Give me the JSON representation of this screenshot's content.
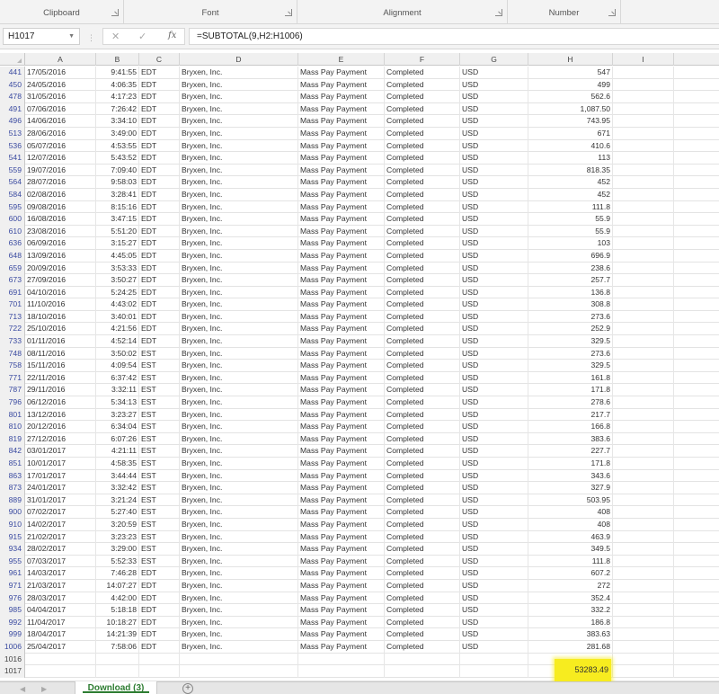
{
  "ribbon": {
    "groups": [
      {
        "label": "Clipboard"
      },
      {
        "label": "Font"
      },
      {
        "label": "Alignment"
      },
      {
        "label": "Number"
      }
    ]
  },
  "formula_bar": {
    "name_box": "H1017",
    "cancel_icon": "✕",
    "enter_icon": "✓",
    "fx_label": "fx",
    "formula": "=SUBTOTAL(9,H2:H1006)"
  },
  "columns": [
    "A",
    "B",
    "C",
    "D",
    "E",
    "F",
    "G",
    "H",
    "I"
  ],
  "rows": [
    {
      "n": "441",
      "A": "17/05/2016",
      "B": "9:41:55",
      "C": "EDT",
      "D": "Bryxen, Inc.",
      "E": "Mass Pay Payment",
      "F": "Completed",
      "G": "USD",
      "H": "547"
    },
    {
      "n": "450",
      "A": "24/05/2016",
      "B": "4:06:35",
      "C": "EDT",
      "D": "Bryxen, Inc.",
      "E": "Mass Pay Payment",
      "F": "Completed",
      "G": "USD",
      "H": "499"
    },
    {
      "n": "478",
      "A": "31/05/2016",
      "B": "4:17:23",
      "C": "EDT",
      "D": "Bryxen, Inc.",
      "E": "Mass Pay Payment",
      "F": "Completed",
      "G": "USD",
      "H": "562.6"
    },
    {
      "n": "491",
      "A": "07/06/2016",
      "B": "7:26:42",
      "C": "EDT",
      "D": "Bryxen, Inc.",
      "E": "Mass Pay Payment",
      "F": "Completed",
      "G": "USD",
      "H": "1,087.50"
    },
    {
      "n": "496",
      "A": "14/06/2016",
      "B": "3:34:10",
      "C": "EDT",
      "D": "Bryxen, Inc.",
      "E": "Mass Pay Payment",
      "F": "Completed",
      "G": "USD",
      "H": "743.95"
    },
    {
      "n": "513",
      "A": "28/06/2016",
      "B": "3:49:00",
      "C": "EDT",
      "D": "Bryxen, Inc.",
      "E": "Mass Pay Payment",
      "F": "Completed",
      "G": "USD",
      "H": "671"
    },
    {
      "n": "536",
      "A": "05/07/2016",
      "B": "4:53:55",
      "C": "EDT",
      "D": "Bryxen, Inc.",
      "E": "Mass Pay Payment",
      "F": "Completed",
      "G": "USD",
      "H": "410.6"
    },
    {
      "n": "541",
      "A": "12/07/2016",
      "B": "5:43:52",
      "C": "EDT",
      "D": "Bryxen, Inc.",
      "E": "Mass Pay Payment",
      "F": "Completed",
      "G": "USD",
      "H": "113"
    },
    {
      "n": "559",
      "A": "19/07/2016",
      "B": "7:09:40",
      "C": "EDT",
      "D": "Bryxen, Inc.",
      "E": "Mass Pay Payment",
      "F": "Completed",
      "G": "USD",
      "H": "818.35"
    },
    {
      "n": "564",
      "A": "28/07/2016",
      "B": "9:58:03",
      "C": "EDT",
      "D": "Bryxen, Inc.",
      "E": "Mass Pay Payment",
      "F": "Completed",
      "G": "USD",
      "H": "452"
    },
    {
      "n": "584",
      "A": "02/08/2016",
      "B": "3:28:41",
      "C": "EDT",
      "D": "Bryxen, Inc.",
      "E": "Mass Pay Payment",
      "F": "Completed",
      "G": "USD",
      "H": "452"
    },
    {
      "n": "595",
      "A": "09/08/2016",
      "B": "8:15:16",
      "C": "EDT",
      "D": "Bryxen, Inc.",
      "E": "Mass Pay Payment",
      "F": "Completed",
      "G": "USD",
      "H": "111.8"
    },
    {
      "n": "600",
      "A": "16/08/2016",
      "B": "3:47:15",
      "C": "EDT",
      "D": "Bryxen, Inc.",
      "E": "Mass Pay Payment",
      "F": "Completed",
      "G": "USD",
      "H": "55.9"
    },
    {
      "n": "610",
      "A": "23/08/2016",
      "B": "5:51:20",
      "C": "EDT",
      "D": "Bryxen, Inc.",
      "E": "Mass Pay Payment",
      "F": "Completed",
      "G": "USD",
      "H": "55.9"
    },
    {
      "n": "636",
      "A": "06/09/2016",
      "B": "3:15:27",
      "C": "EDT",
      "D": "Bryxen, Inc.",
      "E": "Mass Pay Payment",
      "F": "Completed",
      "G": "USD",
      "H": "103"
    },
    {
      "n": "648",
      "A": "13/09/2016",
      "B": "4:45:05",
      "C": "EDT",
      "D": "Bryxen, Inc.",
      "E": "Mass Pay Payment",
      "F": "Completed",
      "G": "USD",
      "H": "696.9"
    },
    {
      "n": "659",
      "A": "20/09/2016",
      "B": "3:53:33",
      "C": "EDT",
      "D": "Bryxen, Inc.",
      "E": "Mass Pay Payment",
      "F": "Completed",
      "G": "USD",
      "H": "238.6"
    },
    {
      "n": "673",
      "A": "27/09/2016",
      "B": "3:50:27",
      "C": "EDT",
      "D": "Bryxen, Inc.",
      "E": "Mass Pay Payment",
      "F": "Completed",
      "G": "USD",
      "H": "257.7"
    },
    {
      "n": "691",
      "A": "04/10/2016",
      "B": "5:24:25",
      "C": "EDT",
      "D": "Bryxen, Inc.",
      "E": "Mass Pay Payment",
      "F": "Completed",
      "G": "USD",
      "H": "136.8"
    },
    {
      "n": "701",
      "A": "11/10/2016",
      "B": "4:43:02",
      "C": "EDT",
      "D": "Bryxen, Inc.",
      "E": "Mass Pay Payment",
      "F": "Completed",
      "G": "USD",
      "H": "308.8"
    },
    {
      "n": "713",
      "A": "18/10/2016",
      "B": "3:40:01",
      "C": "EDT",
      "D": "Bryxen, Inc.",
      "E": "Mass Pay Payment",
      "F": "Completed",
      "G": "USD",
      "H": "273.6"
    },
    {
      "n": "722",
      "A": "25/10/2016",
      "B": "4:21:56",
      "C": "EDT",
      "D": "Bryxen, Inc.",
      "E": "Mass Pay Payment",
      "F": "Completed",
      "G": "USD",
      "H": "252.9"
    },
    {
      "n": "733",
      "A": "01/11/2016",
      "B": "4:52:14",
      "C": "EDT",
      "D": "Bryxen, Inc.",
      "E": "Mass Pay Payment",
      "F": "Completed",
      "G": "USD",
      "H": "329.5"
    },
    {
      "n": "748",
      "A": "08/11/2016",
      "B": "3:50:02",
      "C": "EST",
      "D": "Bryxen, Inc.",
      "E": "Mass Pay Payment",
      "F": "Completed",
      "G": "USD",
      "H": "273.6"
    },
    {
      "n": "758",
      "A": "15/11/2016",
      "B": "4:09:54",
      "C": "EST",
      "D": "Bryxen, Inc.",
      "E": "Mass Pay Payment",
      "F": "Completed",
      "G": "USD",
      "H": "329.5"
    },
    {
      "n": "771",
      "A": "22/11/2016",
      "B": "6:37:42",
      "C": "EST",
      "D": "Bryxen, Inc.",
      "E": "Mass Pay Payment",
      "F": "Completed",
      "G": "USD",
      "H": "161.8"
    },
    {
      "n": "787",
      "A": "29/11/2016",
      "B": "3:32:11",
      "C": "EST",
      "D": "Bryxen, Inc.",
      "E": "Mass Pay Payment",
      "F": "Completed",
      "G": "USD",
      "H": "171.8"
    },
    {
      "n": "796",
      "A": "06/12/2016",
      "B": "5:34:13",
      "C": "EST",
      "D": "Bryxen, Inc.",
      "E": "Mass Pay Payment",
      "F": "Completed",
      "G": "USD",
      "H": "278.6"
    },
    {
      "n": "801",
      "A": "13/12/2016",
      "B": "3:23:27",
      "C": "EST",
      "D": "Bryxen, Inc.",
      "E": "Mass Pay Payment",
      "F": "Completed",
      "G": "USD",
      "H": "217.7"
    },
    {
      "n": "810",
      "A": "20/12/2016",
      "B": "6:34:04",
      "C": "EST",
      "D": "Bryxen, Inc.",
      "E": "Mass Pay Payment",
      "F": "Completed",
      "G": "USD",
      "H": "166.8"
    },
    {
      "n": "819",
      "A": "27/12/2016",
      "B": "6:07:26",
      "C": "EST",
      "D": "Bryxen, Inc.",
      "E": "Mass Pay Payment",
      "F": "Completed",
      "G": "USD",
      "H": "383.6"
    },
    {
      "n": "842",
      "A": "03/01/2017",
      "B": "4:21:11",
      "C": "EST",
      "D": "Bryxen, Inc.",
      "E": "Mass Pay Payment",
      "F": "Completed",
      "G": "USD",
      "H": "227.7"
    },
    {
      "n": "851",
      "A": "10/01/2017",
      "B": "4:58:35",
      "C": "EST",
      "D": "Bryxen, Inc.",
      "E": "Mass Pay Payment",
      "F": "Completed",
      "G": "USD",
      "H": "171.8"
    },
    {
      "n": "863",
      "A": "17/01/2017",
      "B": "3:44:44",
      "C": "EST",
      "D": "Bryxen, Inc.",
      "E": "Mass Pay Payment",
      "F": "Completed",
      "G": "USD",
      "H": "343.6"
    },
    {
      "n": "873",
      "A": "24/01/2017",
      "B": "3:32:42",
      "C": "EST",
      "D": "Bryxen, Inc.",
      "E": "Mass Pay Payment",
      "F": "Completed",
      "G": "USD",
      "H": "327.9"
    },
    {
      "n": "889",
      "A": "31/01/2017",
      "B": "3:21:24",
      "C": "EST",
      "D": "Bryxen, Inc.",
      "E": "Mass Pay Payment",
      "F": "Completed",
      "G": "USD",
      "H": "503.95"
    },
    {
      "n": "900",
      "A": "07/02/2017",
      "B": "5:27:40",
      "C": "EST",
      "D": "Bryxen, Inc.",
      "E": "Mass Pay Payment",
      "F": "Completed",
      "G": "USD",
      "H": "408"
    },
    {
      "n": "910",
      "A": "14/02/2017",
      "B": "3:20:59",
      "C": "EST",
      "D": "Bryxen, Inc.",
      "E": "Mass Pay Payment",
      "F": "Completed",
      "G": "USD",
      "H": "408"
    },
    {
      "n": "915",
      "A": "21/02/2017",
      "B": "3:23:23",
      "C": "EST",
      "D": "Bryxen, Inc.",
      "E": "Mass Pay Payment",
      "F": "Completed",
      "G": "USD",
      "H": "463.9"
    },
    {
      "n": "934",
      "A": "28/02/2017",
      "B": "3:29:00",
      "C": "EST",
      "D": "Bryxen, Inc.",
      "E": "Mass Pay Payment",
      "F": "Completed",
      "G": "USD",
      "H": "349.5"
    },
    {
      "n": "955",
      "A": "07/03/2017",
      "B": "5:52:33",
      "C": "EST",
      "D": "Bryxen, Inc.",
      "E": "Mass Pay Payment",
      "F": "Completed",
      "G": "USD",
      "H": "111.8"
    },
    {
      "n": "961",
      "A": "14/03/2017",
      "B": "7:46:28",
      "C": "EDT",
      "D": "Bryxen, Inc.",
      "E": "Mass Pay Payment",
      "F": "Completed",
      "G": "USD",
      "H": "607.2"
    },
    {
      "n": "971",
      "A": "21/03/2017",
      "B": "14:07:27",
      "C": "EDT",
      "D": "Bryxen, Inc.",
      "E": "Mass Pay Payment",
      "F": "Completed",
      "G": "USD",
      "H": "272"
    },
    {
      "n": "976",
      "A": "28/03/2017",
      "B": "4:42:00",
      "C": "EDT",
      "D": "Bryxen, Inc.",
      "E": "Mass Pay Payment",
      "F": "Completed",
      "G": "USD",
      "H": "352.4"
    },
    {
      "n": "985",
      "A": "04/04/2017",
      "B": "5:18:18",
      "C": "EDT",
      "D": "Bryxen, Inc.",
      "E": "Mass Pay Payment",
      "F": "Completed",
      "G": "USD",
      "H": "332.2"
    },
    {
      "n": "992",
      "A": "11/04/2017",
      "B": "10:18:27",
      "C": "EDT",
      "D": "Bryxen, Inc.",
      "E": "Mass Pay Payment",
      "F": "Completed",
      "G": "USD",
      "H": "186.8"
    },
    {
      "n": "999",
      "A": "18/04/2017",
      "B": "14:21:39",
      "C": "EDT",
      "D": "Bryxen, Inc.",
      "E": "Mass Pay Payment",
      "F": "Completed",
      "G": "USD",
      "H": "383.63"
    },
    {
      "n": "1006",
      "A": "25/04/2017",
      "B": "7:58:06",
      "C": "EDT",
      "D": "Bryxen, Inc.",
      "E": "Mass Pay Payment",
      "F": "Completed",
      "G": "USD",
      "H": "281.68"
    },
    {
      "n": "1016",
      "A": "",
      "B": "",
      "C": "",
      "D": "",
      "E": "",
      "F": "",
      "G": "",
      "H": ""
    },
    {
      "n": "1017",
      "A": "",
      "B": "",
      "C": "",
      "D": "",
      "E": "",
      "F": "",
      "G": "",
      "H": ""
    }
  ],
  "total": {
    "cell": "H1017",
    "value": "53283.49",
    "highlight_color": "#f7ec1f"
  },
  "sheet_tabs": {
    "nav_prev": "◀",
    "nav_next": "▶",
    "active": "Download (3)",
    "add_icon": "+"
  }
}
